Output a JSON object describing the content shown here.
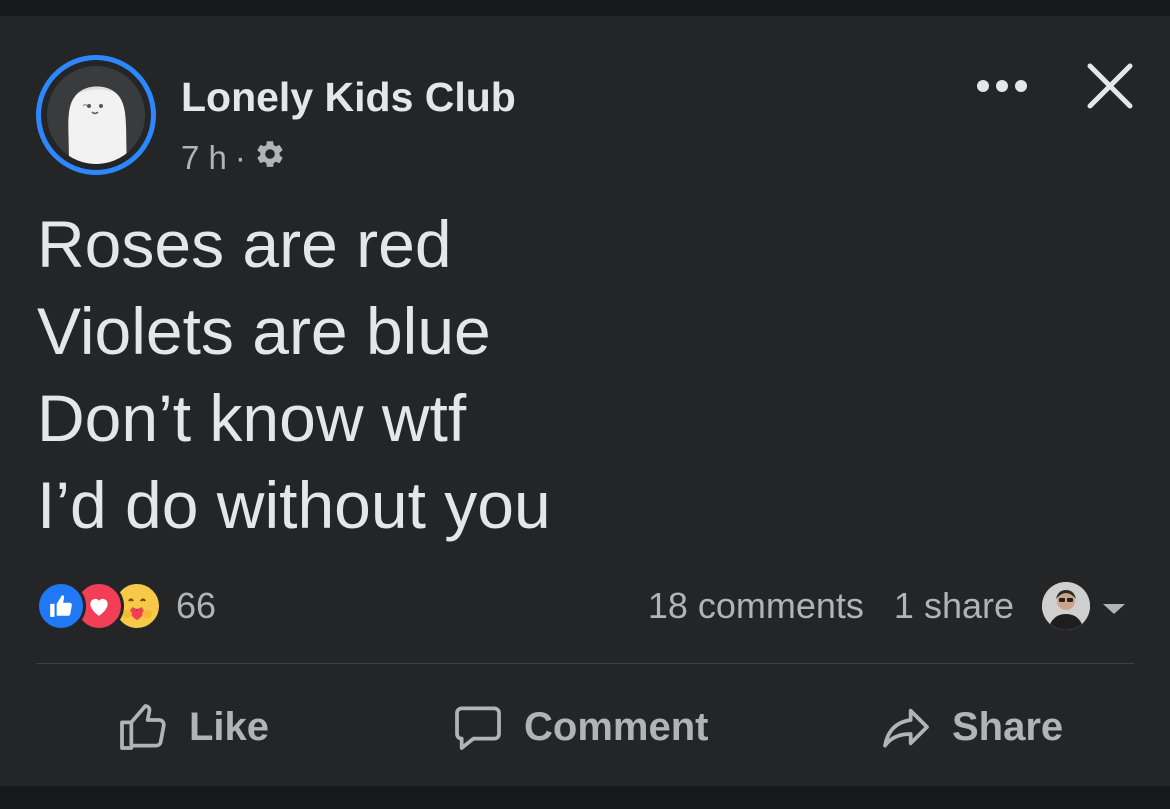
{
  "post": {
    "page_name": "Lonely Kids Club",
    "timestamp": "7 h",
    "separator": "·",
    "privacy_icon": "gear-icon",
    "lines": [
      "Roses are red",
      "Violets are blue",
      "Don’t know wtf",
      "I’d do without you"
    ]
  },
  "header": {
    "more_icon": "more-horizontal-icon",
    "close_icon": "close-icon"
  },
  "stats": {
    "reactions": [
      "like",
      "love",
      "care"
    ],
    "reaction_count": "66",
    "comments": "18 comments",
    "shares": "1 share"
  },
  "actions": {
    "like": "Like",
    "comment": "Comment",
    "share": "Share"
  },
  "colors": {
    "background": "#242526",
    "text": "#e4e6eb",
    "secondary_text": "#b0b3b8",
    "accent_blue": "#2d88ff",
    "like_blue": "#2078f4",
    "love_red": "#f33e58",
    "care_yellow": "#f7c948"
  }
}
